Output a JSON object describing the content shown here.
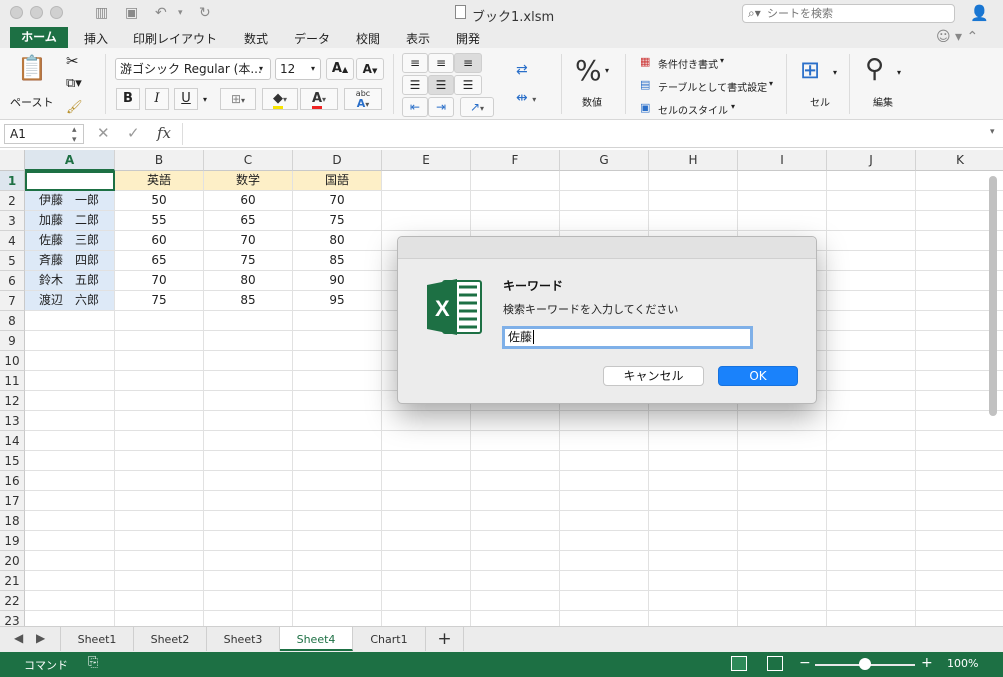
{
  "window": {
    "title": "ブック1.xlsm",
    "search_placeholder": "シートを検索"
  },
  "menu_tabs": [
    {
      "label": "ホーム",
      "active": true
    },
    {
      "label": "挿入"
    },
    {
      "label": "印刷レイアウト"
    },
    {
      "label": "数式"
    },
    {
      "label": "データ"
    },
    {
      "label": "校閲"
    },
    {
      "label": "表示"
    },
    {
      "label": "開発"
    }
  ],
  "ribbon": {
    "paste_label": "ペースト",
    "font_name": "游ゴシック Regular (本...",
    "font_size": "12",
    "bold": "B",
    "italic": "I",
    "underline": "U",
    "number_label": "数値",
    "number_symbol": "%",
    "cond_format": "条件付き書式",
    "format_as_table": "テーブルとして書式設定",
    "cell_styles": "セルのスタイル",
    "cells_label": "セル",
    "edit_label": "編集"
  },
  "formula_bar": {
    "name_box": "A1",
    "fx": "fx",
    "formula": ""
  },
  "sheet": {
    "columns": [
      "A",
      "B",
      "C",
      "D",
      "E",
      "F",
      "G",
      "H",
      "I",
      "J",
      "K"
    ],
    "rows": [
      "1",
      "2",
      "3",
      "4",
      "5",
      "6",
      "7",
      "8",
      "9",
      "10",
      "11",
      "12",
      "13",
      "14",
      "15",
      "16",
      "17",
      "18",
      "19",
      "20",
      "21",
      "22",
      "23"
    ],
    "header_row": [
      "",
      "英語",
      "数学",
      "国語"
    ],
    "data": [
      [
        "伊藤　一郎",
        "50",
        "60",
        "70"
      ],
      [
        "加藤　二郎",
        "55",
        "65",
        "75"
      ],
      [
        "佐藤　三郎",
        "60",
        "70",
        "80"
      ],
      [
        "斉藤　四郎",
        "65",
        "75",
        "85"
      ],
      [
        "鈴木　五郎",
        "70",
        "80",
        "90"
      ],
      [
        "渡辺　六郎",
        "75",
        "85",
        "95"
      ]
    ],
    "selected_cell": "A1"
  },
  "sheet_tabs": [
    {
      "label": "Sheet1"
    },
    {
      "label": "Sheet2"
    },
    {
      "label": "Sheet3"
    },
    {
      "label": "Sheet4",
      "active": true
    },
    {
      "label": "Chart1"
    }
  ],
  "add_sheet": "+",
  "status": {
    "mode": "コマンド",
    "zoom_percent": "100%",
    "zoom_minus": "−",
    "zoom_plus": "+"
  },
  "dialog": {
    "title": "キーワード",
    "message": "検索キーワードを入力してください",
    "input_value": "佐藤",
    "cancel_label": "キャンセル",
    "ok_label": "OK"
  },
  "colors": {
    "accent": "#1d7044",
    "header_fill": "#fdefc7",
    "name_fill": "#dde9f7",
    "ok_button": "#1a82fb"
  }
}
